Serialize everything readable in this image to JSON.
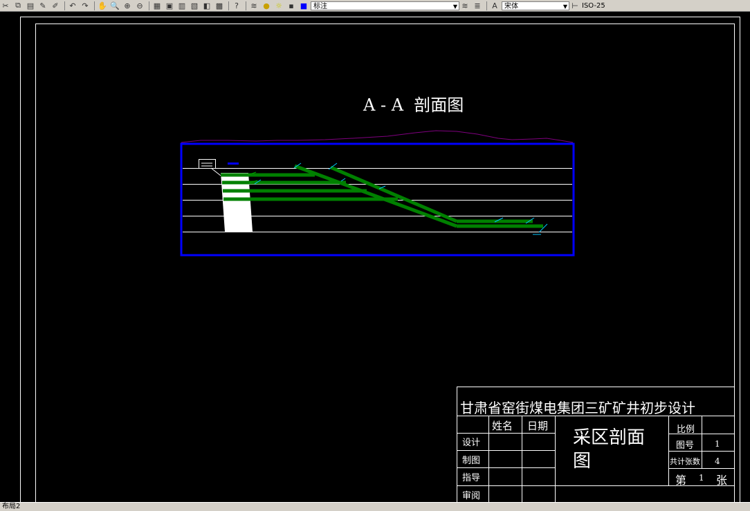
{
  "toolbar": {
    "layer_name": "标注",
    "font_name": "宋体",
    "dim_style": "ISO-25"
  },
  "drawing": {
    "title": "A - A  剖面图"
  },
  "title_block": {
    "project_title": "甘肃省窑街煤电集团三矿矿井初步设计",
    "drawing_name_line1": "采区剖面",
    "drawing_name_line2": "图",
    "col_name": "姓名",
    "col_date": "日期",
    "row_design": "设计",
    "row_draw": "制图",
    "row_guide": "指导",
    "row_review": "审阅",
    "scale_label": "比例",
    "drawing_no_label": "图号",
    "drawing_no": "1",
    "total_sheets_label": "共计张数",
    "total_sheets": "4",
    "sheet_prefix": "第",
    "sheet_no": "1",
    "sheet_suffix": "张"
  },
  "statusbar": {
    "layout_tab": "布局2"
  }
}
